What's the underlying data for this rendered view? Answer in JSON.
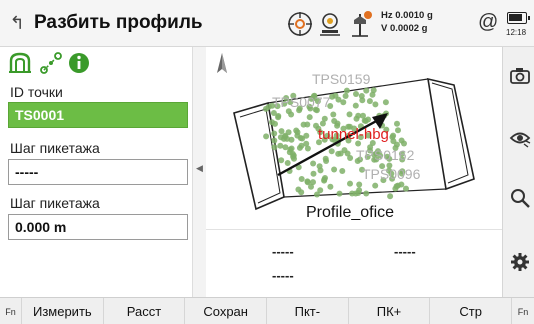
{
  "header": {
    "title": "Разбить профиль",
    "hz": "Hz 0.0010 g",
    "v": "V  0.0002 g",
    "at": "@",
    "time": "12:18"
  },
  "form": {
    "point_id_label": "ID точки",
    "point_id_value": "TS0001",
    "step1_label": "Шаг пикетажа",
    "step1_value": "-----",
    "step2_label": "Шаг пикетажа",
    "step2_value": "0.000 m"
  },
  "map": {
    "labels": {
      "tps0159": "TPS0159",
      "tps0077": "TPS0077",
      "tunnel": "tunnel-hbg",
      "tps0162": "TPS0162",
      "tps0096": "TPS0096",
      "profile": "Profile_ofice"
    }
  },
  "readout": {
    "a": "-----",
    "b": "-----",
    "c": "-----"
  },
  "footer": {
    "fn_left": "Fn",
    "measure": "Измерить",
    "dist": "Расст",
    "save": "Сохран",
    "pkt_minus": "Пкт-",
    "pk_plus": "ПК+",
    "page": "Стр",
    "fn_right": "Fn"
  },
  "icons": {
    "back": "back-icon",
    "target": "target-icon",
    "station": "station-icon",
    "prism": "prism-icon",
    "battery": "battery-icon",
    "camera": "camera-icon",
    "eye": "eye-icon",
    "search": "search-icon",
    "settings": "gear-icon",
    "north": "north-arrow-icon"
  },
  "colors": {
    "selected_field": "#6cbd45",
    "point_dots": "#7fb069",
    "tunnel_label": "#e02020"
  }
}
